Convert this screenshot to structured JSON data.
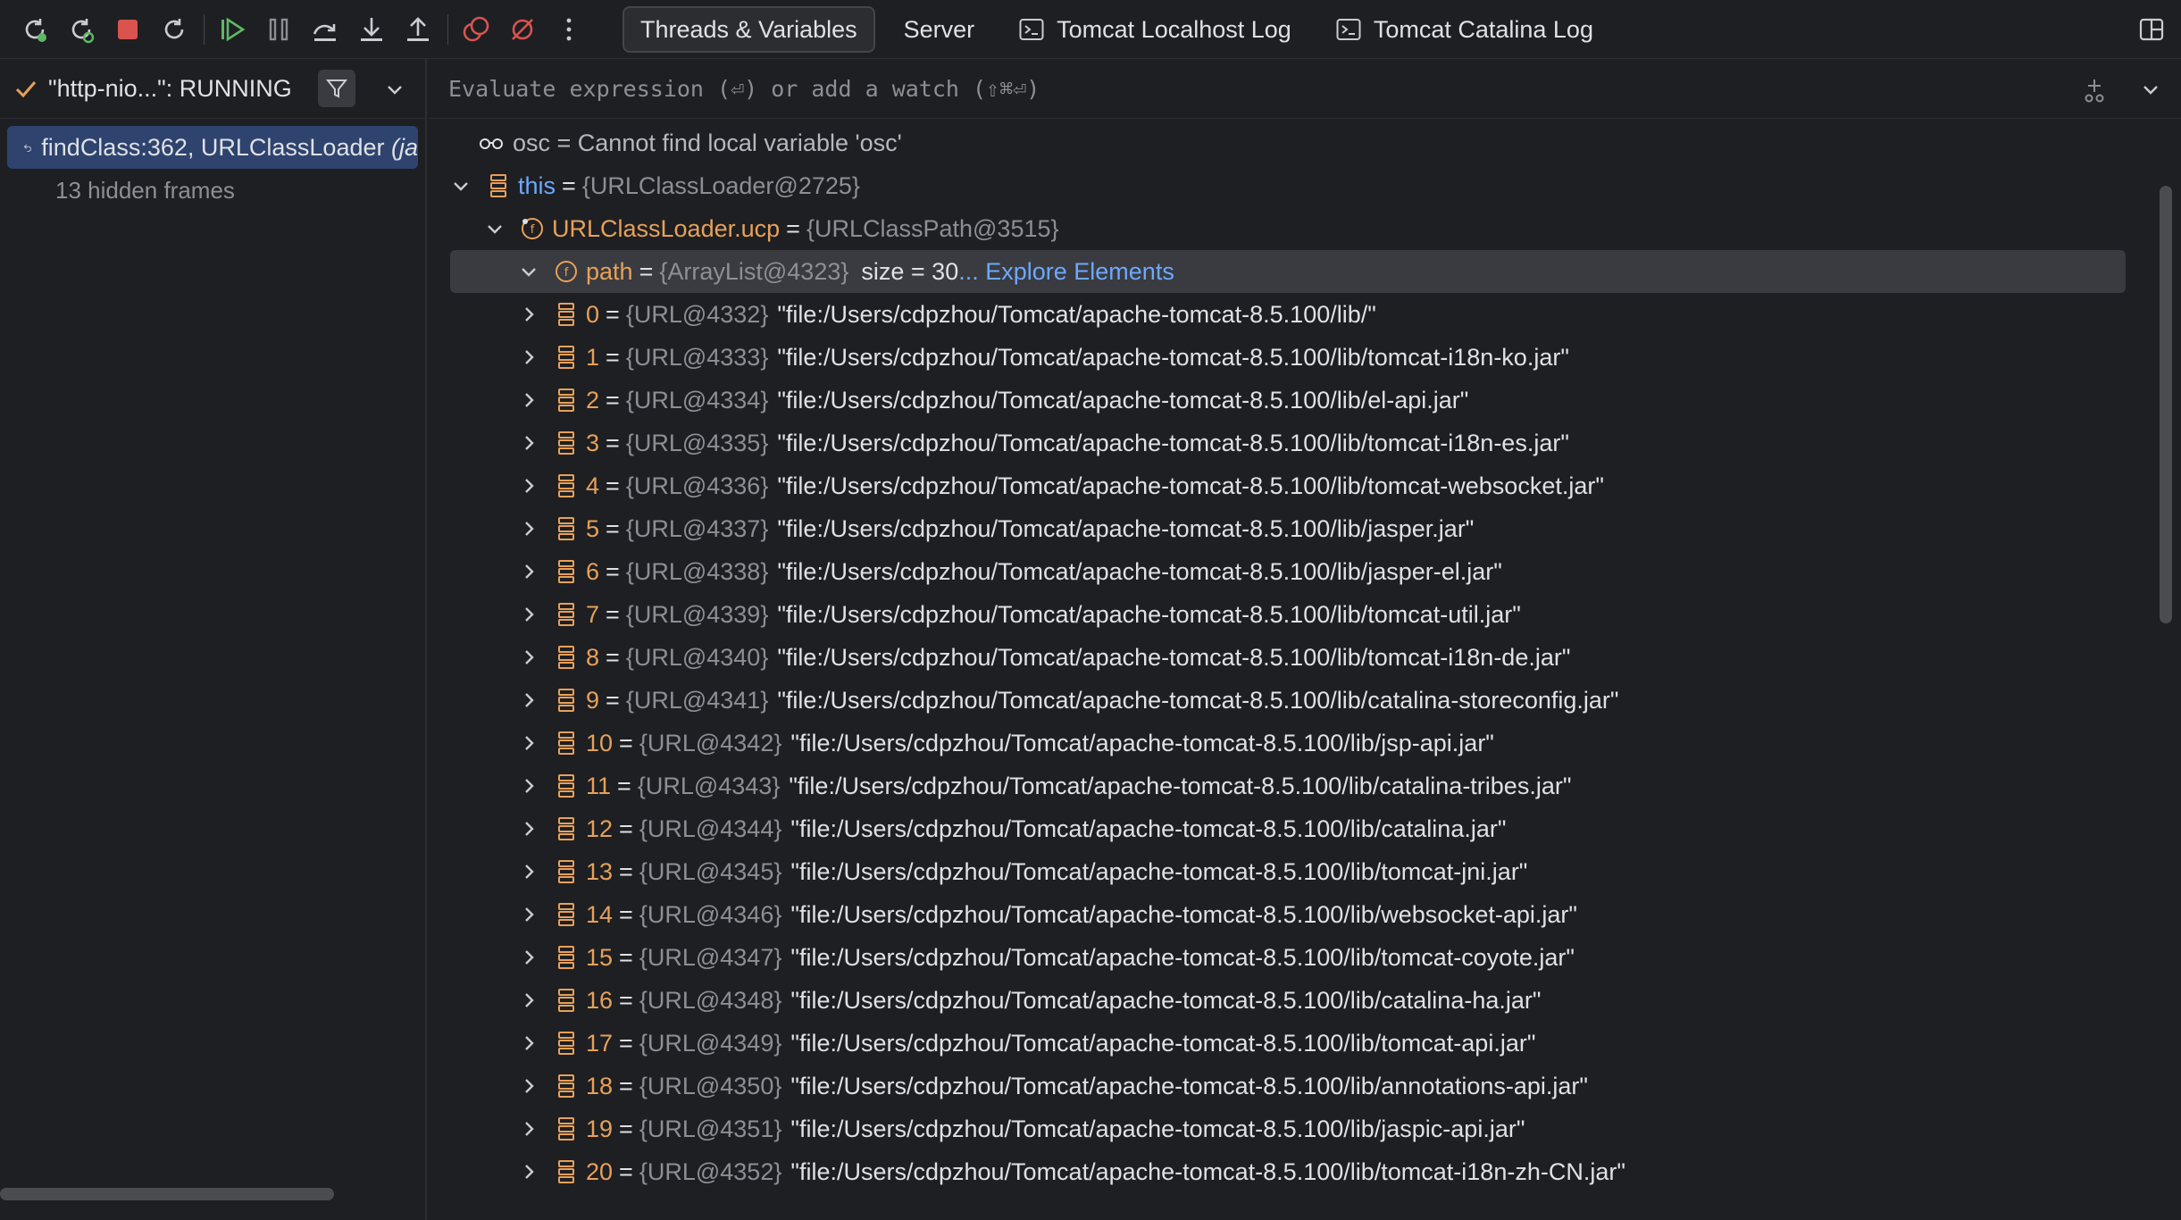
{
  "toolbar": {
    "icons": [
      "rerun-icon",
      "rerun-debug-icon",
      "stop-icon",
      "restart-icon",
      "resume-icon",
      "pause-icon",
      "step-over-icon",
      "step-into-icon",
      "step-out-icon",
      "view-breakpoints-icon",
      "mute-breakpoints-icon",
      "more-icon"
    ],
    "tabs": [
      {
        "label": "Threads & Variables",
        "active": true
      },
      {
        "label": "Server",
        "active": false
      },
      {
        "label": "Tomcat Localhost Log",
        "active": false,
        "icon": "console-icon"
      },
      {
        "label": "Tomcat Catalina Log",
        "active": false,
        "icon": "console-icon"
      }
    ]
  },
  "frames": {
    "thread_label": "\"http-nio...\": RUNNING",
    "selected_frame": "findClass:362, URLClassLoader ",
    "selected_frame_tail": "(ja",
    "hidden_frames": "13 hidden frames"
  },
  "eval": {
    "placeholder": "Evaluate expression (⏎) or add a watch (⇧⌘⏎)"
  },
  "tree": {
    "osc": {
      "text": "osc = Cannot find local variable 'osc'"
    },
    "this": {
      "name": "this",
      "type": "{URLClassLoader@2725}"
    },
    "ucp": {
      "name": "URLClassLoader.ucp",
      "type": "{URLClassPath@3515}"
    },
    "path": {
      "name": "path",
      "type": "{ArrayList@4323}",
      "size": "size = 30",
      "explore": "... Explore Elements"
    },
    "items": [
      {
        "index": "0",
        "type": "{URL@4332}",
        "value": "\"file:/Users/cdpzhou/Tomcat/apache-tomcat-8.5.100/lib/\""
      },
      {
        "index": "1",
        "type": "{URL@4333}",
        "value": "\"file:/Users/cdpzhou/Tomcat/apache-tomcat-8.5.100/lib/tomcat-i18n-ko.jar\""
      },
      {
        "index": "2",
        "type": "{URL@4334}",
        "value": "\"file:/Users/cdpzhou/Tomcat/apache-tomcat-8.5.100/lib/el-api.jar\""
      },
      {
        "index": "3",
        "type": "{URL@4335}",
        "value": "\"file:/Users/cdpzhou/Tomcat/apache-tomcat-8.5.100/lib/tomcat-i18n-es.jar\""
      },
      {
        "index": "4",
        "type": "{URL@4336}",
        "value": "\"file:/Users/cdpzhou/Tomcat/apache-tomcat-8.5.100/lib/tomcat-websocket.jar\""
      },
      {
        "index": "5",
        "type": "{URL@4337}",
        "value": "\"file:/Users/cdpzhou/Tomcat/apache-tomcat-8.5.100/lib/jasper.jar\""
      },
      {
        "index": "6",
        "type": "{URL@4338}",
        "value": "\"file:/Users/cdpzhou/Tomcat/apache-tomcat-8.5.100/lib/jasper-el.jar\""
      },
      {
        "index": "7",
        "type": "{URL@4339}",
        "value": "\"file:/Users/cdpzhou/Tomcat/apache-tomcat-8.5.100/lib/tomcat-util.jar\""
      },
      {
        "index": "8",
        "type": "{URL@4340}",
        "value": "\"file:/Users/cdpzhou/Tomcat/apache-tomcat-8.5.100/lib/tomcat-i18n-de.jar\""
      },
      {
        "index": "9",
        "type": "{URL@4341}",
        "value": "\"file:/Users/cdpzhou/Tomcat/apache-tomcat-8.5.100/lib/catalina-storeconfig.jar\""
      },
      {
        "index": "10",
        "type": "{URL@4342}",
        "value": "\"file:/Users/cdpzhou/Tomcat/apache-tomcat-8.5.100/lib/jsp-api.jar\""
      },
      {
        "index": "11",
        "type": "{URL@4343}",
        "value": "\"file:/Users/cdpzhou/Tomcat/apache-tomcat-8.5.100/lib/catalina-tribes.jar\""
      },
      {
        "index": "12",
        "type": "{URL@4344}",
        "value": "\"file:/Users/cdpzhou/Tomcat/apache-tomcat-8.5.100/lib/catalina.jar\""
      },
      {
        "index": "13",
        "type": "{URL@4345}",
        "value": "\"file:/Users/cdpzhou/Tomcat/apache-tomcat-8.5.100/lib/tomcat-jni.jar\""
      },
      {
        "index": "14",
        "type": "{URL@4346}",
        "value": "\"file:/Users/cdpzhou/Tomcat/apache-tomcat-8.5.100/lib/websocket-api.jar\""
      },
      {
        "index": "15",
        "type": "{URL@4347}",
        "value": "\"file:/Users/cdpzhou/Tomcat/apache-tomcat-8.5.100/lib/tomcat-coyote.jar\""
      },
      {
        "index": "16",
        "type": "{URL@4348}",
        "value": "\"file:/Users/cdpzhou/Tomcat/apache-tomcat-8.5.100/lib/catalina-ha.jar\""
      },
      {
        "index": "17",
        "type": "{URL@4349}",
        "value": "\"file:/Users/cdpzhou/Tomcat/apache-tomcat-8.5.100/lib/tomcat-api.jar\""
      },
      {
        "index": "18",
        "type": "{URL@4350}",
        "value": "\"file:/Users/cdpzhou/Tomcat/apache-tomcat-8.5.100/lib/annotations-api.jar\""
      },
      {
        "index": "19",
        "type": "{URL@4351}",
        "value": "\"file:/Users/cdpzhou/Tomcat/apache-tomcat-8.5.100/lib/jaspic-api.jar\""
      },
      {
        "index": "20",
        "type": "{URL@4352}",
        "value": "\"file:/Users/cdpzhou/Tomcat/apache-tomcat-8.5.100/lib/tomcat-i18n-zh-CN.jar\""
      }
    ]
  },
  "colors": {
    "background": "#1e1f22",
    "field_name": "#e7a15a",
    "keyword": "#6ea8fe",
    "link": "#6ea8fe",
    "type_muted": "#8c8f94",
    "selection": "#2e436e"
  }
}
